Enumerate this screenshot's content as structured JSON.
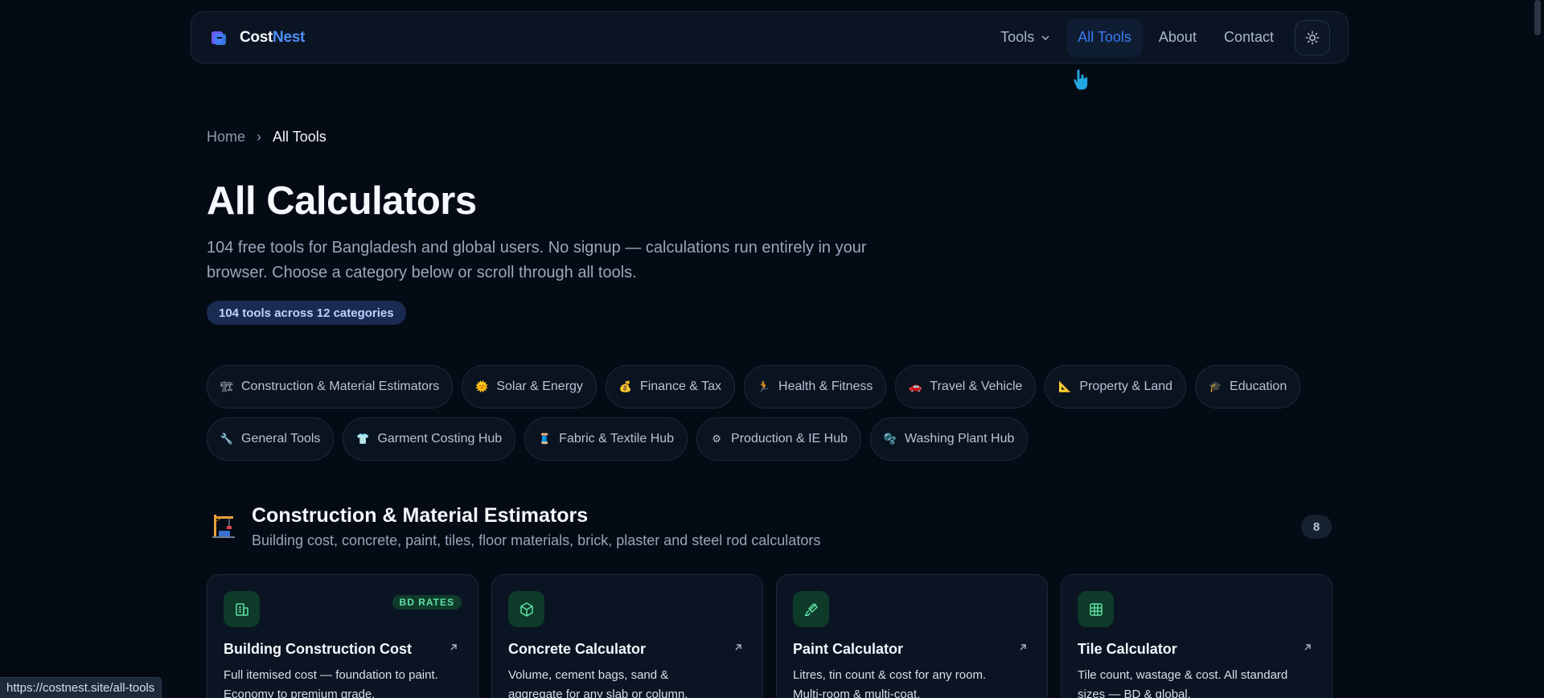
{
  "nav": {
    "brand_a": "Cost",
    "brand_b": "Nest",
    "links": [
      {
        "label": "Tools"
      },
      {
        "label": "All Tools"
      },
      {
        "label": "About"
      },
      {
        "label": "Contact"
      }
    ]
  },
  "breadcrumb": {
    "home": "Home",
    "sep": "›",
    "current": "All Tools"
  },
  "page": {
    "title": "All Calculators",
    "lead": "104 free tools for Bangladesh and global users. No signup — calculations run entirely in your browser. Choose a category below or scroll through all tools.",
    "count_badge": "104 tools across 12 categories"
  },
  "categories": [
    {
      "label": "Construction & Material Estimators",
      "icon": "crane-icon",
      "glyph": "🏗"
    },
    {
      "label": "Solar & Energy",
      "icon": "sun-icon",
      "glyph": "🌞"
    },
    {
      "label": "Finance & Tax",
      "icon": "money-bag-icon",
      "glyph": "💰"
    },
    {
      "label": "Health & Fitness",
      "icon": "runner-icon",
      "glyph": "🏃"
    },
    {
      "label": "Travel & Vehicle",
      "icon": "car-icon",
      "glyph": "🚗"
    },
    {
      "label": "Property & Land",
      "icon": "ruler-icon",
      "glyph": "📐"
    },
    {
      "label": "Education",
      "icon": "graduation-cap-icon",
      "glyph": "🎓"
    },
    {
      "label": "General Tools",
      "icon": "wrench-icon",
      "glyph": "🔧"
    },
    {
      "label": "Garment Costing Hub",
      "icon": "shirt-icon",
      "glyph": "👕"
    },
    {
      "label": "Fabric & Textile Hub",
      "icon": "thread-icon",
      "glyph": "🧵"
    },
    {
      "label": "Production & IE Hub",
      "icon": "gear-icon",
      "glyph": "⚙"
    },
    {
      "label": "Washing Plant Hub",
      "icon": "bubbles-icon",
      "glyph": "🫧"
    }
  ],
  "section": {
    "title": "Construction & Material Estimators",
    "subtitle": "Building cost, concrete, paint, tiles, floor materials, brick, plaster and steel rod calculators",
    "count": "8"
  },
  "cards": [
    {
      "title": "Building Construction Cost",
      "desc": "Full itemised cost — foundation to paint. Economy to premium grade.",
      "badge": "BD RATES",
      "icon": "building-icon"
    },
    {
      "title": "Concrete Calculator",
      "desc": "Volume, cement bags, sand & aggregate for any slab or column.",
      "icon": "cube-icon"
    },
    {
      "title": "Paint Calculator",
      "desc": "Litres, tin count & cost for any room. Multi-room & multi-coat.",
      "icon": "paint-brush-icon"
    },
    {
      "title": "Tile Calculator",
      "desc": "Tile count, wastage & cost. All standard sizes — BD & global.",
      "icon": "grid-icon"
    }
  ],
  "status_url": "https://costnest.site/all-tools",
  "colors": {
    "accent": "#3a7bf0",
    "brand_blue": "#4f8ff7",
    "green": "#5ee0a1",
    "bg": "#050b15"
  }
}
